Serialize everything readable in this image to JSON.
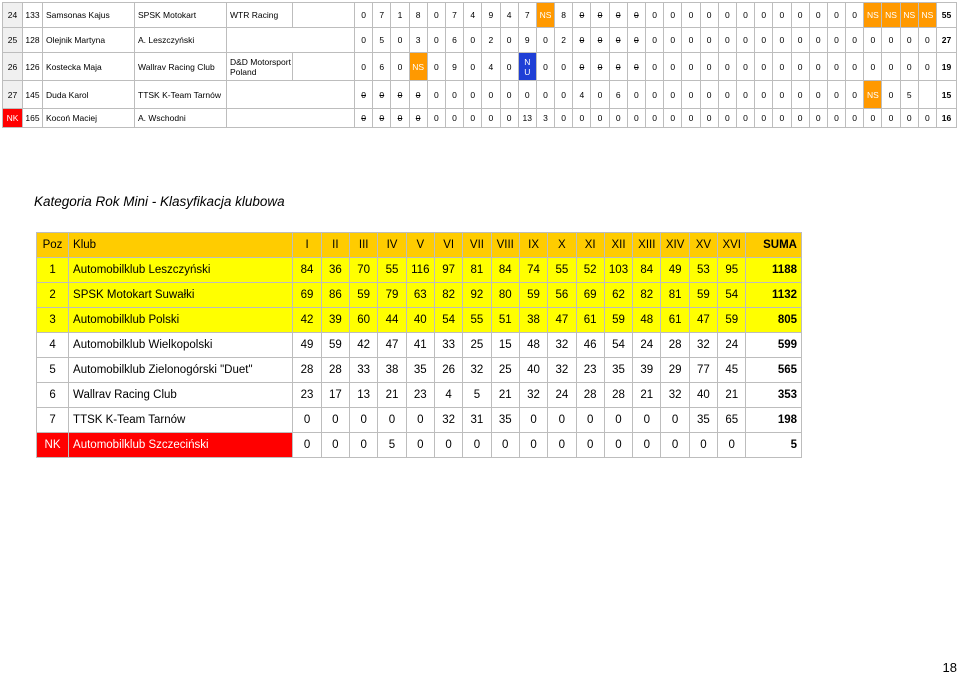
{
  "drivers": [
    {
      "pos": "24",
      "num": "133",
      "name": "Samsonas Kajus",
      "club": "SPSK Motokart",
      "team": "WTR Racing",
      "scores": [
        {
          "v": "0"
        },
        {
          "v": "7"
        },
        {
          "v": "1"
        },
        {
          "v": "8"
        },
        {
          "v": "0"
        },
        {
          "v": "7"
        },
        {
          "v": "4"
        },
        {
          "v": "9"
        },
        {
          "v": "4"
        },
        {
          "v": "7"
        },
        {
          "v": "NS",
          "style": "ns"
        },
        {
          "v": "8"
        },
        {
          "v": "0",
          "strike": true
        },
        {
          "v": "0",
          "strike": true
        },
        {
          "v": "0",
          "strike": true
        },
        {
          "v": "0",
          "strike": true
        },
        {
          "v": "0"
        },
        {
          "v": "0"
        },
        {
          "v": "0"
        },
        {
          "v": "0"
        },
        {
          "v": "0"
        },
        {
          "v": "0"
        },
        {
          "v": "0"
        },
        {
          "v": "0"
        },
        {
          "v": "0"
        },
        {
          "v": "0"
        },
        {
          "v": "0"
        },
        {
          "v": "0"
        },
        {
          "v": "NS",
          "style": "ns"
        },
        {
          "v": "NS",
          "style": "ns"
        },
        {
          "v": "NS",
          "style": "ns"
        },
        {
          "v": "NS",
          "style": "ns"
        }
      ],
      "sum": "55"
    },
    {
      "pos": "25",
      "num": "128",
      "name": "Olejnik Martyna",
      "club": "A. Leszczyński",
      "team": "",
      "scores": [
        {
          "v": "0"
        },
        {
          "v": "5"
        },
        {
          "v": "0"
        },
        {
          "v": "3"
        },
        {
          "v": "0"
        },
        {
          "v": "6"
        },
        {
          "v": "0"
        },
        {
          "v": "2"
        },
        {
          "v": "0"
        },
        {
          "v": "9"
        },
        {
          "v": "0"
        },
        {
          "v": "2"
        },
        {
          "v": "0",
          "strike": true
        },
        {
          "v": "0",
          "strike": true
        },
        {
          "v": "0",
          "strike": true
        },
        {
          "v": "0",
          "strike": true
        },
        {
          "v": "0"
        },
        {
          "v": "0"
        },
        {
          "v": "0"
        },
        {
          "v": "0"
        },
        {
          "v": "0"
        },
        {
          "v": "0"
        },
        {
          "v": "0"
        },
        {
          "v": "0"
        },
        {
          "v": "0"
        },
        {
          "v": "0"
        },
        {
          "v": "0"
        },
        {
          "v": "0"
        },
        {
          "v": "0"
        },
        {
          "v": "0"
        },
        {
          "v": "0"
        },
        {
          "v": "0"
        }
      ],
      "sum": "27"
    },
    {
      "pos": "26",
      "num": "126",
      "name": "Kostecka Maja",
      "club": "Wallrav Racing Club",
      "team": "D&D Motorsport Poland",
      "scores": [
        {
          "v": "0"
        },
        {
          "v": "6"
        },
        {
          "v": "0"
        },
        {
          "v": "NS",
          "style": "ns"
        },
        {
          "v": "0"
        },
        {
          "v": "9"
        },
        {
          "v": "0"
        },
        {
          "v": "4"
        },
        {
          "v": "0"
        },
        {
          "v": "N U",
          "style": "nsb"
        },
        {
          "v": "0"
        },
        {
          "v": "0"
        },
        {
          "v": "0",
          "strike": true
        },
        {
          "v": "0",
          "strike": true
        },
        {
          "v": "0",
          "strike": true
        },
        {
          "v": "0",
          "strike": true
        },
        {
          "v": "0"
        },
        {
          "v": "0"
        },
        {
          "v": "0"
        },
        {
          "v": "0"
        },
        {
          "v": "0"
        },
        {
          "v": "0"
        },
        {
          "v": "0"
        },
        {
          "v": "0"
        },
        {
          "v": "0"
        },
        {
          "v": "0"
        },
        {
          "v": "0"
        },
        {
          "v": "0"
        },
        {
          "v": "0"
        },
        {
          "v": "0"
        },
        {
          "v": "0"
        },
        {
          "v": "0"
        }
      ],
      "sum": "19"
    },
    {
      "pos": "27",
      "num": "145",
      "name": "Duda Karol",
      "club": "TTSK K-Team Tarnów",
      "team": "",
      "scores": [
        {
          "v": "0",
          "strike": true
        },
        {
          "v": "0",
          "strike": true
        },
        {
          "v": "0",
          "strike": true
        },
        {
          "v": "0",
          "strike": true
        },
        {
          "v": "0"
        },
        {
          "v": "0"
        },
        {
          "v": "0"
        },
        {
          "v": "0"
        },
        {
          "v": "0"
        },
        {
          "v": "0"
        },
        {
          "v": "0"
        },
        {
          "v": "0"
        },
        {
          "v": "4"
        },
        {
          "v": "0"
        },
        {
          "v": "6"
        },
        {
          "v": "0"
        },
        {
          "v": "0"
        },
        {
          "v": "0"
        },
        {
          "v": "0"
        },
        {
          "v": "0"
        },
        {
          "v": "0"
        },
        {
          "v": "0"
        },
        {
          "v": "0"
        },
        {
          "v": "0"
        },
        {
          "v": "0"
        },
        {
          "v": "0"
        },
        {
          "v": "0"
        },
        {
          "v": "0"
        },
        {
          "v": "NS",
          "style": "ns"
        },
        {
          "v": "0"
        },
        {
          "v": "5"
        },
        {
          "v": ""
        }
      ],
      "sum": "15"
    },
    {
      "pos": "NK",
      "num": "165",
      "name": "Kocoń Maciej",
      "club": "A. Wschodni",
      "team": "",
      "nk": true,
      "scores": [
        {
          "v": "0",
          "strike": true
        },
        {
          "v": "0",
          "strike": true
        },
        {
          "v": "0",
          "strike": true
        },
        {
          "v": "0",
          "strike": true
        },
        {
          "v": "0"
        },
        {
          "v": "0"
        },
        {
          "v": "0"
        },
        {
          "v": "0"
        },
        {
          "v": "0"
        },
        {
          "v": "13"
        },
        {
          "v": "3"
        },
        {
          "v": "0"
        },
        {
          "v": "0"
        },
        {
          "v": "0"
        },
        {
          "v": "0"
        },
        {
          "v": "0"
        },
        {
          "v": "0"
        },
        {
          "v": "0"
        },
        {
          "v": "0"
        },
        {
          "v": "0"
        },
        {
          "v": "0"
        },
        {
          "v": "0"
        },
        {
          "v": "0"
        },
        {
          "v": "0"
        },
        {
          "v": "0"
        },
        {
          "v": "0"
        },
        {
          "v": "0"
        },
        {
          "v": "0"
        },
        {
          "v": "0"
        },
        {
          "v": "0"
        },
        {
          "v": "0"
        },
        {
          "v": "0"
        }
      ],
      "sum": "16"
    }
  ],
  "section_title": "Kategoria Rok Mini  - Klasyfikacja klubowa",
  "club_table": {
    "headers": [
      "Poz",
      "Klub",
      "I",
      "II",
      "III",
      "IV",
      "V",
      "VI",
      "VII",
      "VIII",
      "IX",
      "X",
      "XI",
      "XII",
      "XIII",
      "XIV",
      "XV",
      "XVI",
      "SUMA"
    ],
    "rows": [
      {
        "pos": "1",
        "club": "Automobilklub  Leszczyński",
        "values": [
          "84",
          "36",
          "70",
          "55",
          "116",
          "97",
          "81",
          "84",
          "74",
          "55",
          "52",
          "103",
          "84",
          "49",
          "53",
          "95"
        ],
        "sum": "1188",
        "highlight": "yellow"
      },
      {
        "pos": "2",
        "club": "SPSK Motokart Suwałki",
        "values": [
          "69",
          "86",
          "59",
          "79",
          "63",
          "82",
          "92",
          "80",
          "59",
          "56",
          "69",
          "62",
          "82",
          "81",
          "59",
          "54"
        ],
        "sum": "1132",
        "highlight": "yellow"
      },
      {
        "pos": "3",
        "club": "Automobilklub  Polski",
        "values": [
          "42",
          "39",
          "60",
          "44",
          "40",
          "54",
          "55",
          "51",
          "38",
          "47",
          "61",
          "59",
          "48",
          "61",
          "47",
          "59"
        ],
        "sum": "805",
        "highlight": "yellow"
      },
      {
        "pos": "4",
        "club": "Automobilklub  Wielkopolski",
        "values": [
          "49",
          "59",
          "42",
          "47",
          "41",
          "33",
          "25",
          "15",
          "48",
          "32",
          "46",
          "54",
          "24",
          "28",
          "32",
          "24"
        ],
        "sum": "599",
        "highlight": ""
      },
      {
        "pos": "5",
        "club": "Automobilklub Zielonogórski \"Duet\"",
        "values": [
          "28",
          "28",
          "33",
          "38",
          "35",
          "26",
          "32",
          "25",
          "40",
          "32",
          "23",
          "35",
          "39",
          "29",
          "77",
          "45"
        ],
        "sum": "565",
        "highlight": ""
      },
      {
        "pos": "6",
        "club": "Wallrav Racing Club",
        "values": [
          "23",
          "17",
          "13",
          "21",
          "23",
          "4",
          "5",
          "21",
          "32",
          "24",
          "28",
          "28",
          "21",
          "32",
          "40",
          "21"
        ],
        "sum": "353",
        "highlight": ""
      },
      {
        "pos": "7",
        "club": " TTSK K-Team Tarnów",
        "values": [
          "0",
          "0",
          "0",
          "0",
          "0",
          "32",
          "31",
          "35",
          "0",
          "0",
          "0",
          "0",
          "0",
          "0",
          "35",
          "65"
        ],
        "sum": "198",
        "highlight": ""
      },
      {
        "pos": "NK",
        "club": "Automobilklub  Szczeciński",
        "values": [
          "0",
          "0",
          "0",
          "5",
          "0",
          "0",
          "0",
          "0",
          "0",
          "0",
          "0",
          "0",
          "0",
          "0",
          "0",
          "0"
        ],
        "sum": "5",
        "highlight": "nk"
      }
    ]
  },
  "page_number": "18",
  "colors": {
    "ns": "#ff9900",
    "nu": "#1f3fd6",
    "nk": "#ff0000",
    "header": "#ffcc00",
    "top3": "#ffff00"
  }
}
